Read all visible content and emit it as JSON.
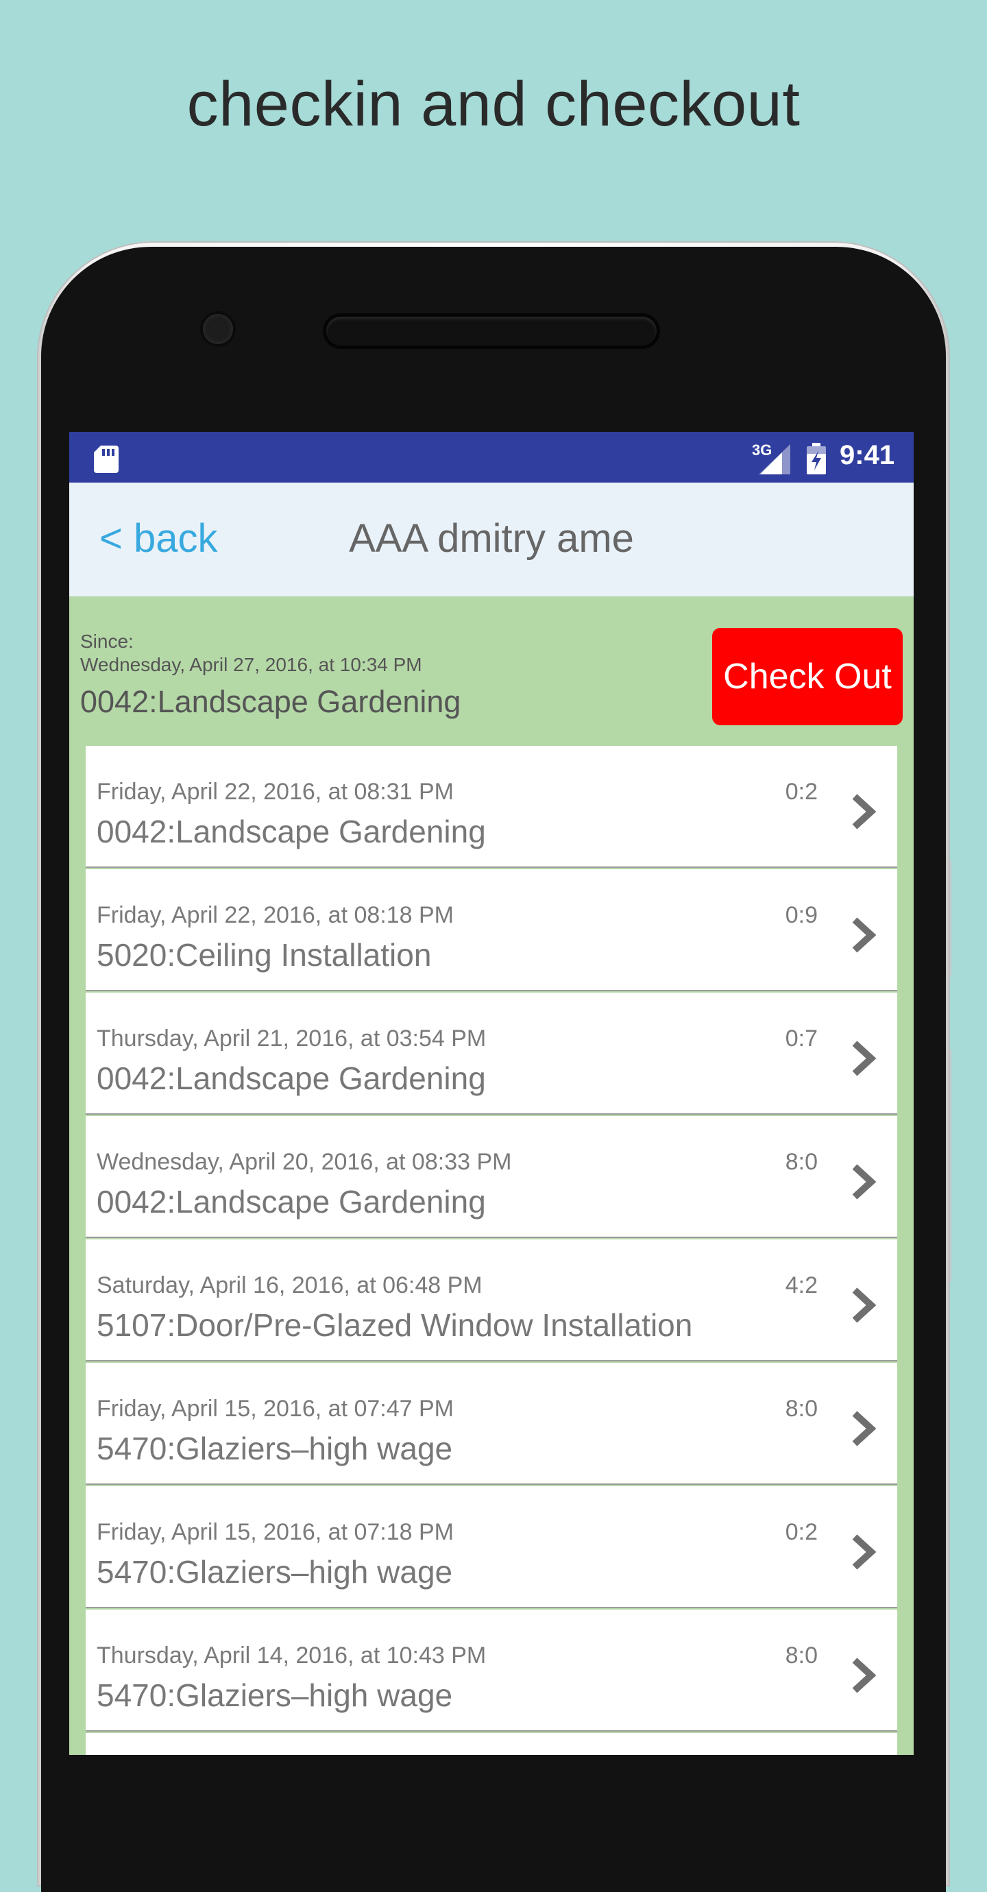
{
  "headline": "checkin and checkout",
  "status_bar": {
    "network": "3G",
    "time": "9:41",
    "icons": [
      "sd-card-icon",
      "signal-icon",
      "battery-charging-icon"
    ]
  },
  "nav": {
    "back_label": "< back",
    "title": "AAA dmitry ame"
  },
  "current": {
    "since_label": "Since:",
    "since_date": "Wednesday, April 27, 2016, at 10:34 PM",
    "task": "0042:Landscape Gardening",
    "checkout_label": "Check Out"
  },
  "history": [
    {
      "date": "Friday, April 22, 2016, at 08:31 PM",
      "task": "0042:Landscape Gardening",
      "hours": "0:2"
    },
    {
      "date": "Friday, April 22, 2016, at 08:18 PM",
      "task": "5020:Ceiling Installation",
      "hours": "0:9"
    },
    {
      "date": "Thursday, April 21, 2016, at 03:54 PM",
      "task": "0042:Landscape Gardening",
      "hours": "0:7"
    },
    {
      "date": "Wednesday, April 20, 2016, at 08:33 PM",
      "task": "0042:Landscape Gardening",
      "hours": "8:0"
    },
    {
      "date": "Saturday, April 16, 2016, at 06:48 PM",
      "task": "5107:Door/Pre-Glazed Window Installation",
      "hours": "4:2"
    },
    {
      "date": "Friday, April 15, 2016, at 07:47 PM",
      "task": "5470:Glaziers–high wage",
      "hours": "8:0"
    },
    {
      "date": "Friday, April 15, 2016, at 07:18 PM",
      "task": "5470:Glaziers–high wage",
      "hours": "0:2"
    },
    {
      "date": "Thursday, April 14, 2016, at 10:43 PM",
      "task": "5470:Glaziers–high wage",
      "hours": "8:0"
    },
    {
      "date": "",
      "task": "",
      "hours": ""
    }
  ],
  "colors": {
    "background": "#a6dbd7",
    "status_bar": "#303f9f",
    "nav_bar": "#eaf2f9",
    "current_block": "#b5d8a7",
    "checkout_button": "#fe0000",
    "back_link": "#38a9df"
  }
}
